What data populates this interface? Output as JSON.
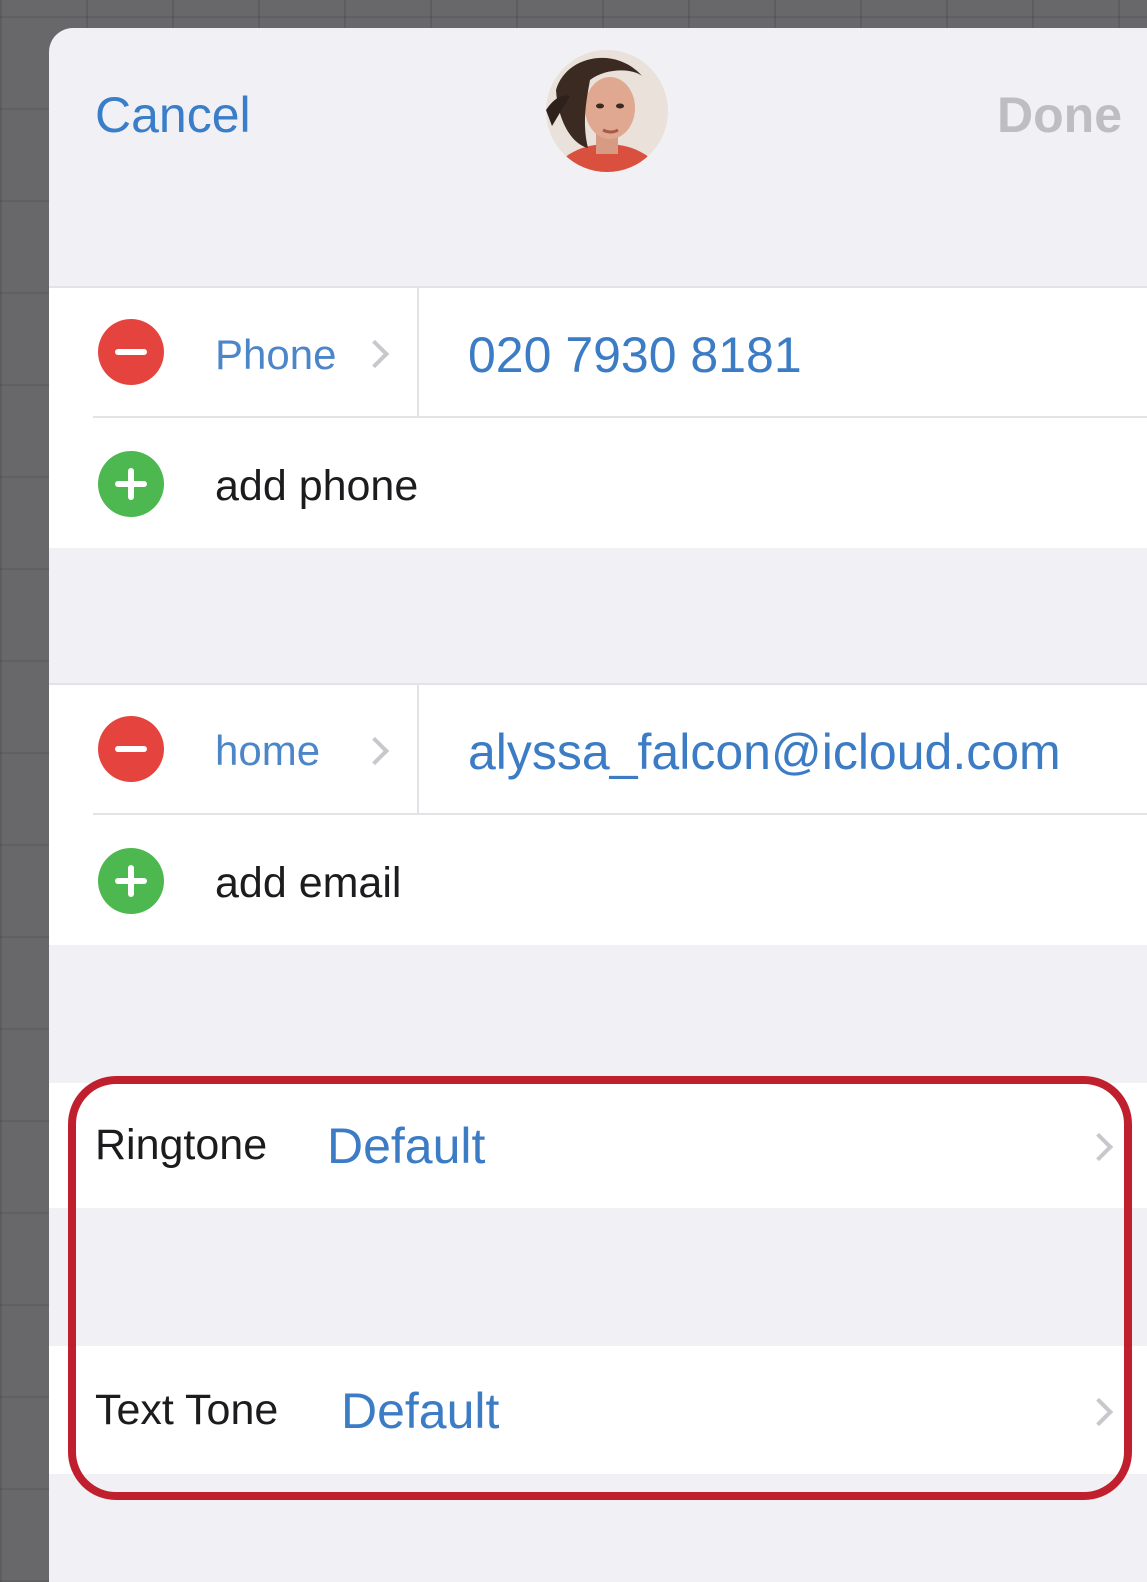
{
  "nav": {
    "cancel_label": "Cancel",
    "done_label": "Done"
  },
  "phone_section": {
    "label": "Phone",
    "value": "020 7930 8181",
    "add_label": "add phone"
  },
  "email_section": {
    "label": "home",
    "value": "alyssa_falcon@icloud.com",
    "add_label": "add email"
  },
  "tones": {
    "ringtone_label": "Ringtone",
    "ringtone_value": "Default",
    "texttone_label": "Text Tone",
    "texttone_value": "Default"
  },
  "colors": {
    "accent": "#3a7dc9",
    "remove": "#e5443e",
    "add": "#4cb84f",
    "highlight": "#c0202e"
  },
  "icons": [
    "remove-circle-icon",
    "add-circle-icon",
    "chevron-right-icon"
  ]
}
